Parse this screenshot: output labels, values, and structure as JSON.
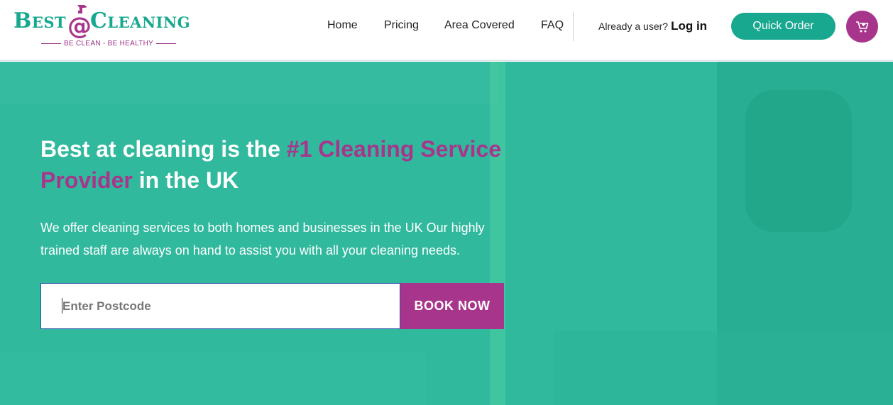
{
  "logo": {
    "word_best": "Best",
    "word_cleaning": "Cleaning",
    "at_symbol": "@",
    "tagline": "BE CLEAN - BE HEALTHY",
    "brand_teal": "#18a88f",
    "brand_purple": "#a8358c"
  },
  "nav": {
    "items": [
      {
        "label": "Home"
      },
      {
        "label": "Pricing"
      },
      {
        "label": "Area Covered"
      },
      {
        "label": "FAQ"
      }
    ]
  },
  "account": {
    "prompt": "Already a user?",
    "login_label": "Log in"
  },
  "actions": {
    "quick_order_label": "Quick Order",
    "cart_icon": "cart-icon"
  },
  "hero": {
    "title_part1": "Best at cleaning is the ",
    "title_accent": "#1 Cleaning Service Provider",
    "title_part2": " in the UK",
    "description": "We offer cleaning services to both homes and businesses in the UK Our highly trained staff are always on hand to assist you with all your cleaning needs.",
    "postcode_placeholder": "Enter Postcode",
    "postcode_value": "",
    "book_label": "BOOK NOW",
    "background_color": "#2fb89c"
  }
}
